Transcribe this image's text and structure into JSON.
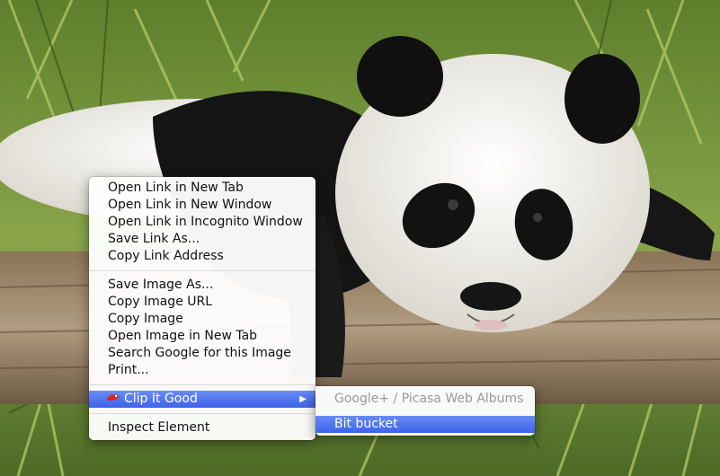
{
  "context_menu": {
    "group_link": [
      "Open Link in New Tab",
      "Open Link in New Window",
      "Open Link in Incognito Window",
      "Save Link As...",
      "Copy Link Address"
    ],
    "group_image": [
      "Save Image As...",
      "Copy Image URL",
      "Copy Image",
      "Open Image in New Tab",
      "Search Google for this Image",
      "Print..."
    ],
    "extension_item": "Clip It Good",
    "inspect_item": "Inspect Element"
  },
  "submenu": {
    "items": [
      {
        "label": "Google+ / Picasa Web Albums",
        "state": "disabled"
      },
      {
        "label": "Bit bucket",
        "state": "highlighted"
      }
    ]
  },
  "icons": {
    "extension_icon": "red-clip-icon",
    "submenu_arrow": "triangle-right-icon"
  },
  "colors": {
    "highlight": "#4a6ff0",
    "disabled_text": "#9a9a9a"
  }
}
